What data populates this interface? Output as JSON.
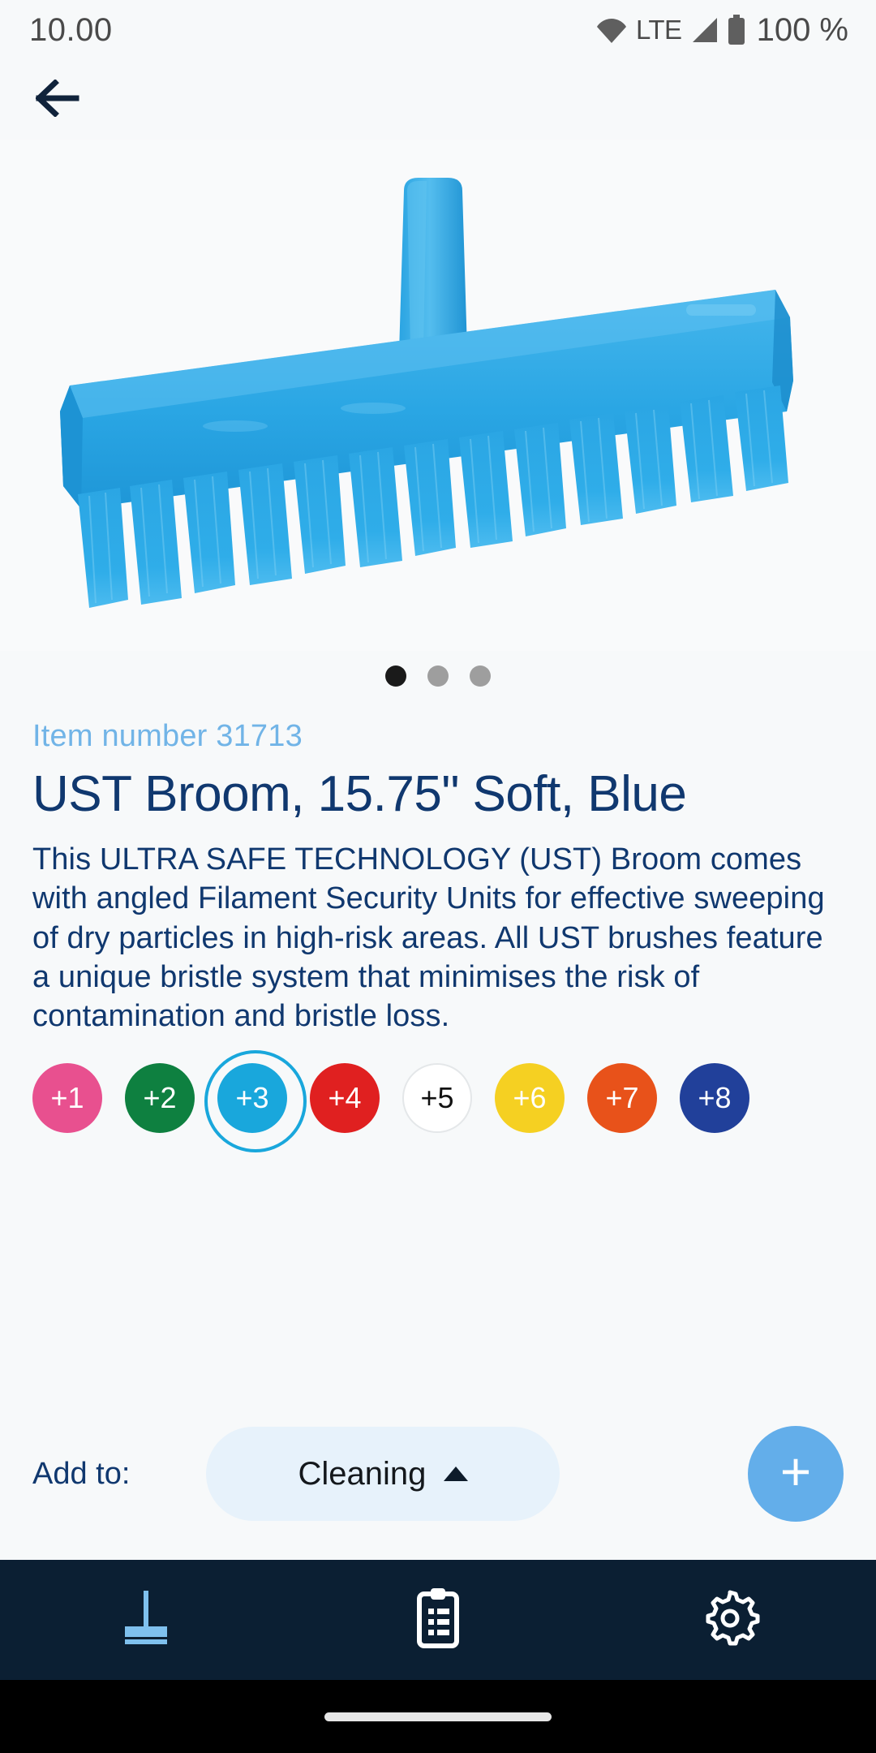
{
  "status_bar": {
    "clock": "10.00",
    "network_label": "LTE",
    "battery_label": "100 %",
    "icons": [
      "wifi-icon",
      "signal-icon",
      "battery-icon"
    ]
  },
  "top_bar": {
    "back_icon": "arrow-left-icon"
  },
  "product": {
    "image_alt": "blue-broom-head",
    "item_number": "Item number 31713",
    "title": "UST Broom, 15.75\" Soft, Blue",
    "description": "This ULTRA SAFE TECHNOLOGY (UST) Broom comes with angled Filament Security Units for effective sweeping of dry particles in high-risk areas. All UST brushes feature a unique bristle system that minimises the risk of contamination and bristle loss."
  },
  "carousel": {
    "total": 3,
    "active_index": 0,
    "dots": [
      "1",
      "2",
      "3"
    ]
  },
  "variants": [
    {
      "label": "+1",
      "color": "#e8508f",
      "text_color": "#ffffff",
      "selected": false
    },
    {
      "label": "+2",
      "color": "#0e8040",
      "text_color": "#ffffff",
      "selected": false
    },
    {
      "label": "+3",
      "color": "#19a7dc",
      "text_color": "#ffffff",
      "selected": true
    },
    {
      "label": "+4",
      "color": "#e02020",
      "text_color": "#ffffff",
      "selected": false
    },
    {
      "label": "+5",
      "color": "#ffffff",
      "text_color": "#111111",
      "selected": false
    },
    {
      "label": "+6",
      "color": "#f5d022",
      "text_color": "#ffffff",
      "selected": false
    },
    {
      "label": "+7",
      "color": "#e8521a",
      "text_color": "#ffffff",
      "selected": false
    },
    {
      "label": "+8",
      "color": "#21409a",
      "text_color": "#ffffff",
      "selected": false
    }
  ],
  "add_to": {
    "label": "Add to:",
    "dropdown_value": "Cleaning",
    "dropdown_caret": "caret-up-icon",
    "add_button_label": "+"
  },
  "bottom_nav": {
    "items": [
      {
        "name": "broom-icon",
        "active": true
      },
      {
        "name": "clipboard-icon",
        "active": false
      },
      {
        "name": "gear-icon",
        "active": false
      }
    ]
  },
  "theme": {
    "brand_navy": "#10386f",
    "accent_light_blue": "#71b4e7",
    "nav_background": "#0b1f33",
    "page_background": "#f7f9fa",
    "fab_blue": "#63aeea",
    "dropdown_background": "#e7f2fb"
  }
}
